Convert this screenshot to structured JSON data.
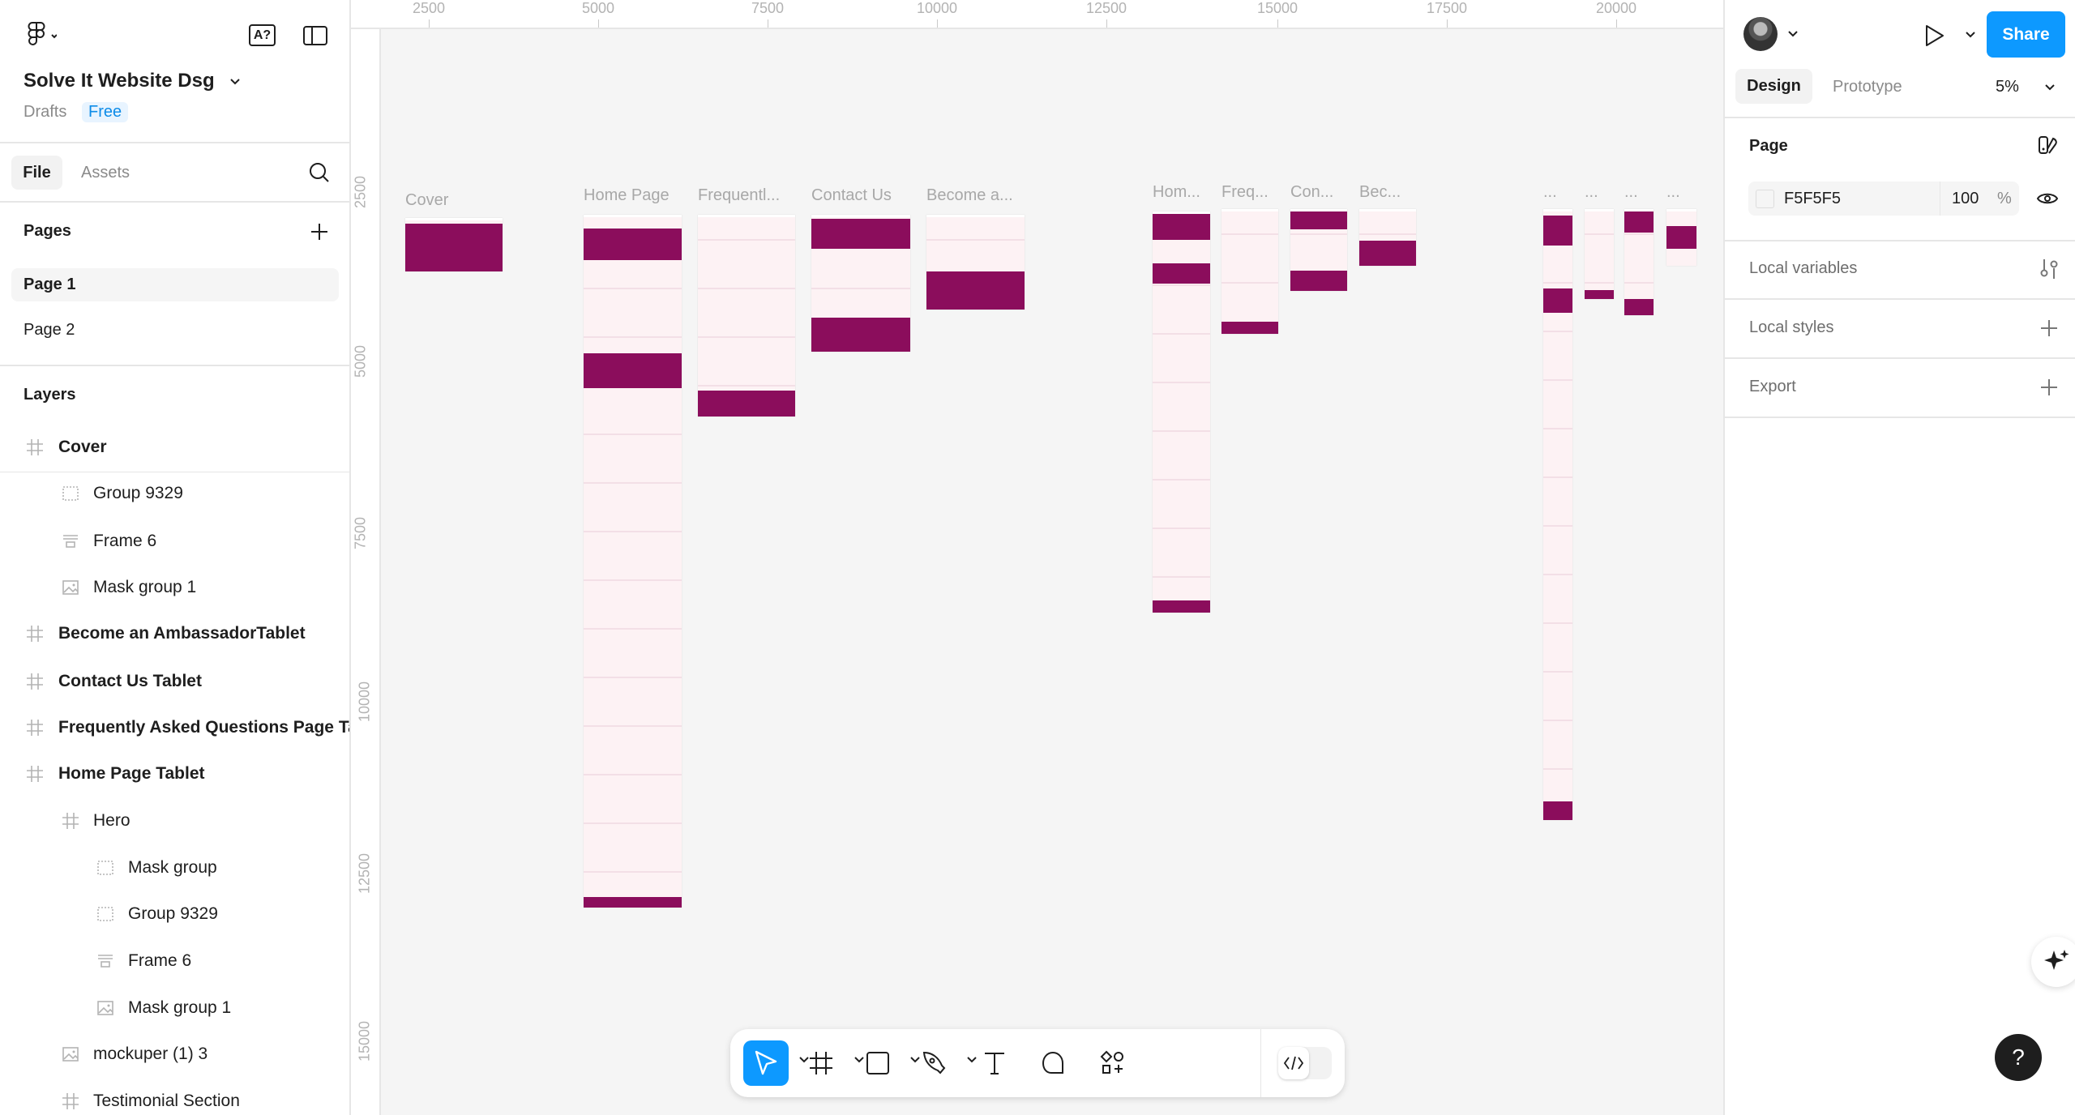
{
  "app": {
    "file_title": "Solve It Website Dsg",
    "location": "Drafts",
    "plan_badge": "Free"
  },
  "left_tabs": {
    "file": "File",
    "assets": "Assets"
  },
  "pages": {
    "heading": "Pages",
    "items": [
      {
        "label": "Page 1",
        "selected": true
      },
      {
        "label": "Page 2",
        "selected": false
      }
    ]
  },
  "layers": {
    "heading": "Layers",
    "items": [
      {
        "label": "Cover",
        "icon": "frame-icon",
        "level": 0,
        "bold": true
      },
      {
        "label": "Group 9329",
        "icon": "group-icon",
        "level": 1
      },
      {
        "label": "Frame 6",
        "icon": "autolayout-icon",
        "level": 1
      },
      {
        "label": "Mask group 1",
        "icon": "image-icon",
        "level": 1
      },
      {
        "label": "Become an AmbassadorTablet",
        "icon": "frame-icon",
        "level": 0,
        "bold": true
      },
      {
        "label": " Contact Us Tablet",
        "icon": "frame-icon",
        "level": 0,
        "bold": true
      },
      {
        "label": "Frequently Asked Questions Page Tablet",
        "icon": "frame-icon",
        "level": 0,
        "bold": true
      },
      {
        "label": "Home Page Tablet",
        "icon": "frame-icon",
        "level": 0,
        "bold": true
      },
      {
        "label": "Hero",
        "icon": "frame-icon",
        "level": 1
      },
      {
        "label": "Mask group",
        "icon": "group-icon",
        "level": 2
      },
      {
        "label": "Group 9329",
        "icon": "group-icon",
        "level": 2
      },
      {
        "label": "Frame 6",
        "icon": "autolayout-icon",
        "level": 2
      },
      {
        "label": "Mask group 1",
        "icon": "image-icon",
        "level": 2
      },
      {
        "label": "mockuper (1) 3",
        "icon": "image-icon",
        "level": 1
      },
      {
        "label": "Testimonial Section",
        "icon": "frame-icon",
        "level": 1
      }
    ]
  },
  "ruler": {
    "x_ticks": [
      "2500",
      "5000",
      "7500",
      "10000",
      "12500",
      "15000",
      "17500",
      "20000"
    ],
    "y_ticks": [
      "2500",
      "5000",
      "7500",
      "10000",
      "12500",
      "15000"
    ]
  },
  "canvas": {
    "background": "#F5F5F5",
    "brand_color": "#8B0D5C",
    "frames": [
      {
        "label": "Cover"
      },
      {
        "label": "Home Page"
      },
      {
        "label": "Frequentl..."
      },
      {
        "label": "Contact Us"
      },
      {
        "label": "Become a..."
      },
      {
        "label": "Hom..."
      },
      {
        "label": "Freq..."
      },
      {
        "label": "Con..."
      },
      {
        "label": "Bec..."
      },
      {
        "label": "..."
      },
      {
        "label": "..."
      },
      {
        "label": "..."
      },
      {
        "label": "..."
      }
    ]
  },
  "right": {
    "share": "Share",
    "tabs": {
      "design": "Design",
      "prototype": "Prototype"
    },
    "zoom": "5%",
    "page_section": {
      "heading": "Page",
      "color_hex": "F5F5F5",
      "opacity": "100",
      "opacity_unit": "%"
    },
    "local_variables": "Local variables",
    "local_styles": "Local styles",
    "export": "Export",
    "accent": "#0D99FF"
  },
  "help": "?",
  "toolbar": {
    "active_tool": "move"
  }
}
